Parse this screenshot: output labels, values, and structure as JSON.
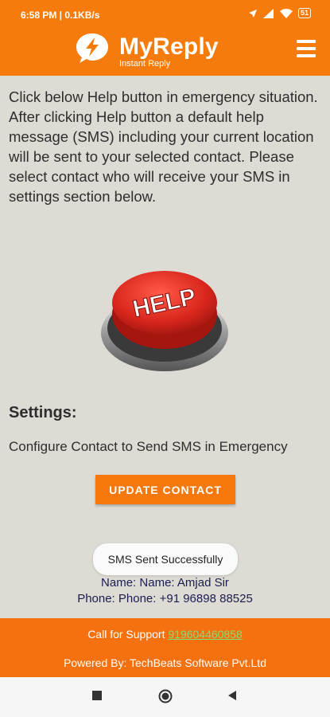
{
  "status_bar": {
    "time": "6:58 PM | 0.1KB/s",
    "battery": "51"
  },
  "app": {
    "title": "MyReply",
    "subtitle": "Instant Reply"
  },
  "intro_text": "Click below Help button in emergency situation. After clicking Help button a default help message (SMS) including your current location will be sent to your selected contact. Please select contact who will receive your SMS in settings section below.",
  "help_button": {
    "label": "HELP"
  },
  "settings": {
    "title": "Settings:",
    "description": "Configure Contact to Send SMS in Emergency",
    "update_label": "UPDATE CONTACT"
  },
  "toast": "SMS Sent Successfully",
  "contact": {
    "name": "Name: Name: Amjad Sir",
    "phone": "Phone: Phone: +91 96898 88525"
  },
  "footer": {
    "support_prefix": "Call for Support",
    "support_number": "919604460858",
    "powered_by": "Powered By: TechBeats Software Pvt.Ltd"
  },
  "colors": {
    "brand": "#f57c0c",
    "link": "#7de07a",
    "help_red": "#d9261c"
  },
  "icons": [
    "lightning-bubble-logo",
    "hamburger-menu-icon",
    "square-nav-icon",
    "circle-nav-icon",
    "triangle-back-icon"
  ]
}
